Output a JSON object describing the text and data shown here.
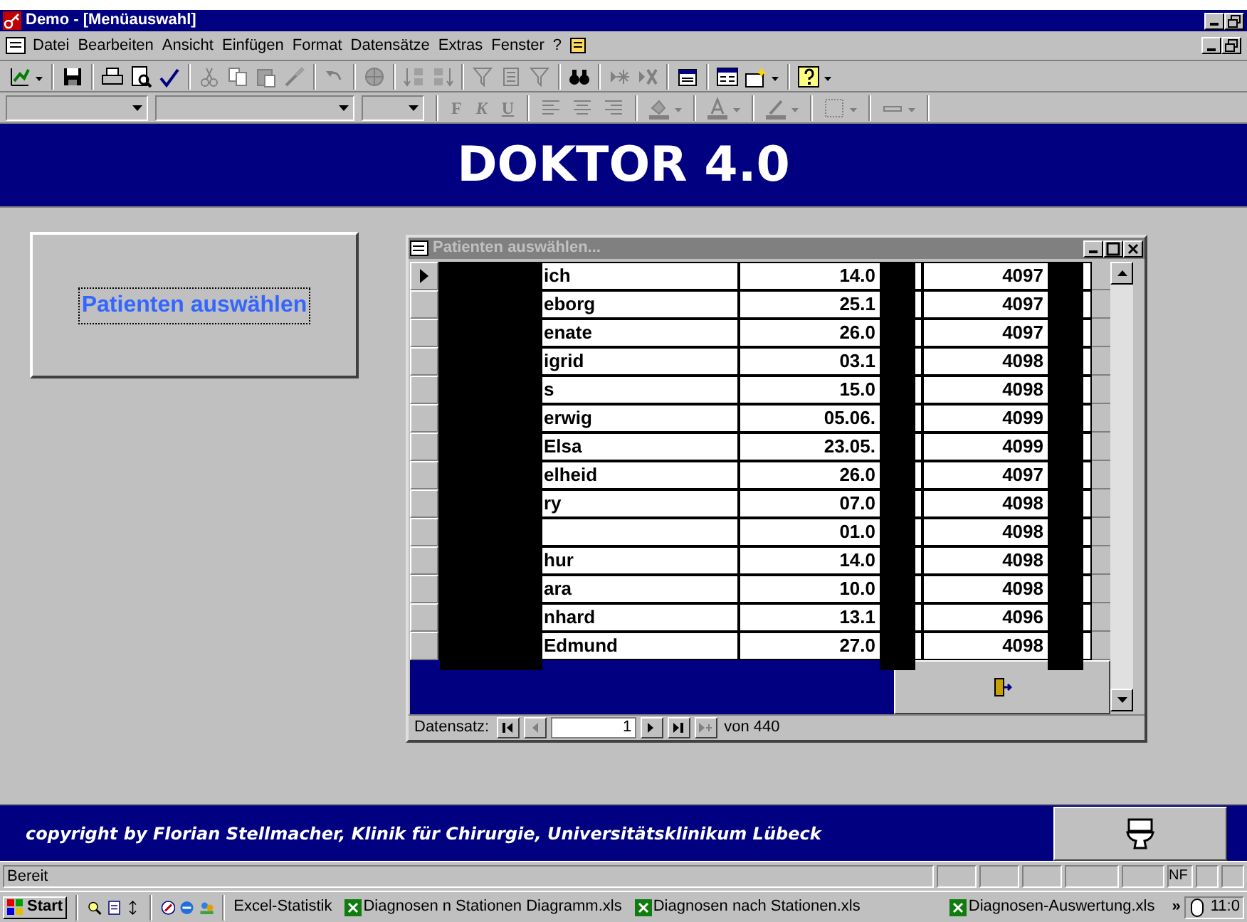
{
  "window": {
    "title": "Demo - [Menüauswahl]"
  },
  "menu": [
    "Datei",
    "Bearbeiten",
    "Ansicht",
    "Einfügen",
    "Format",
    "Datensätze",
    "Extras",
    "Fenster",
    "?"
  ],
  "format_toolbar": {
    "bold": "F",
    "italic": "K",
    "underline": "U"
  },
  "header": {
    "title": "DOKTOR 4.0"
  },
  "select_button": {
    "label": "Patienten auswählen"
  },
  "patients_window": {
    "title": "Patienten auswählen...",
    "rows": [
      {
        "name": "ich",
        "date": "14.0",
        "id": "4097",
        "selected": true
      },
      {
        "name": "eborg",
        "date": "25.1",
        "id": "4097",
        "selected": false
      },
      {
        "name": "enate",
        "date": "26.0",
        "id": "4097",
        "selected": false
      },
      {
        "name": "igrid",
        "date": "03.1",
        "id": "4098",
        "selected": false
      },
      {
        "name": "s",
        "date": "15.0",
        "id": "4098",
        "selected": false
      },
      {
        "name": "erwig",
        "date": "05.06.",
        "id": "4099",
        "selected": false
      },
      {
        "name": "Elsa",
        "date": "23.05.",
        "id": "4099",
        "selected": false
      },
      {
        "name": "elheid",
        "date": "26.0",
        "id": "4097",
        "selected": false
      },
      {
        "name": "ry",
        "date": "07.0",
        "id": "4098",
        "selected": false
      },
      {
        "date": "01.0",
        "id": "4098",
        "selected": false
      },
      {
        "name": "hur",
        "date": "14.0",
        "id": "4098",
        "selected": false
      },
      {
        "name": "ara",
        "date": "10.0",
        "id": "4098",
        "selected": false
      },
      {
        "name": "nhard",
        "date": "13.1",
        "id": "4096",
        "selected": false
      },
      {
        "name": "Edmund",
        "date": "27.0",
        "id": "4098",
        "selected": false
      }
    ],
    "navigation": {
      "label": "Datensatz:",
      "record": "1",
      "of": "von",
      "total": "440"
    }
  },
  "footer": {
    "copyright": "copyright by Florian Stellmacher, Klinik für Chirurgie, Universitätsklinikum Lübeck"
  },
  "status_bar": {
    "text": "Bereit",
    "indicator": "NF"
  },
  "taskbar": {
    "start": "Start",
    "tasks": [
      {
        "label": "Excel-Statistik",
        "kind": "plain"
      },
      {
        "label": "Diagnosen n Stationen Diagramm.xls",
        "kind": "excel"
      },
      {
        "label": "Diagnosen nach Stationen.xls",
        "kind": "excel"
      },
      {
        "label": "Diagnosen-Auswertung.xls",
        "kind": "excel"
      }
    ],
    "more": "»",
    "clock": "11:0"
  }
}
